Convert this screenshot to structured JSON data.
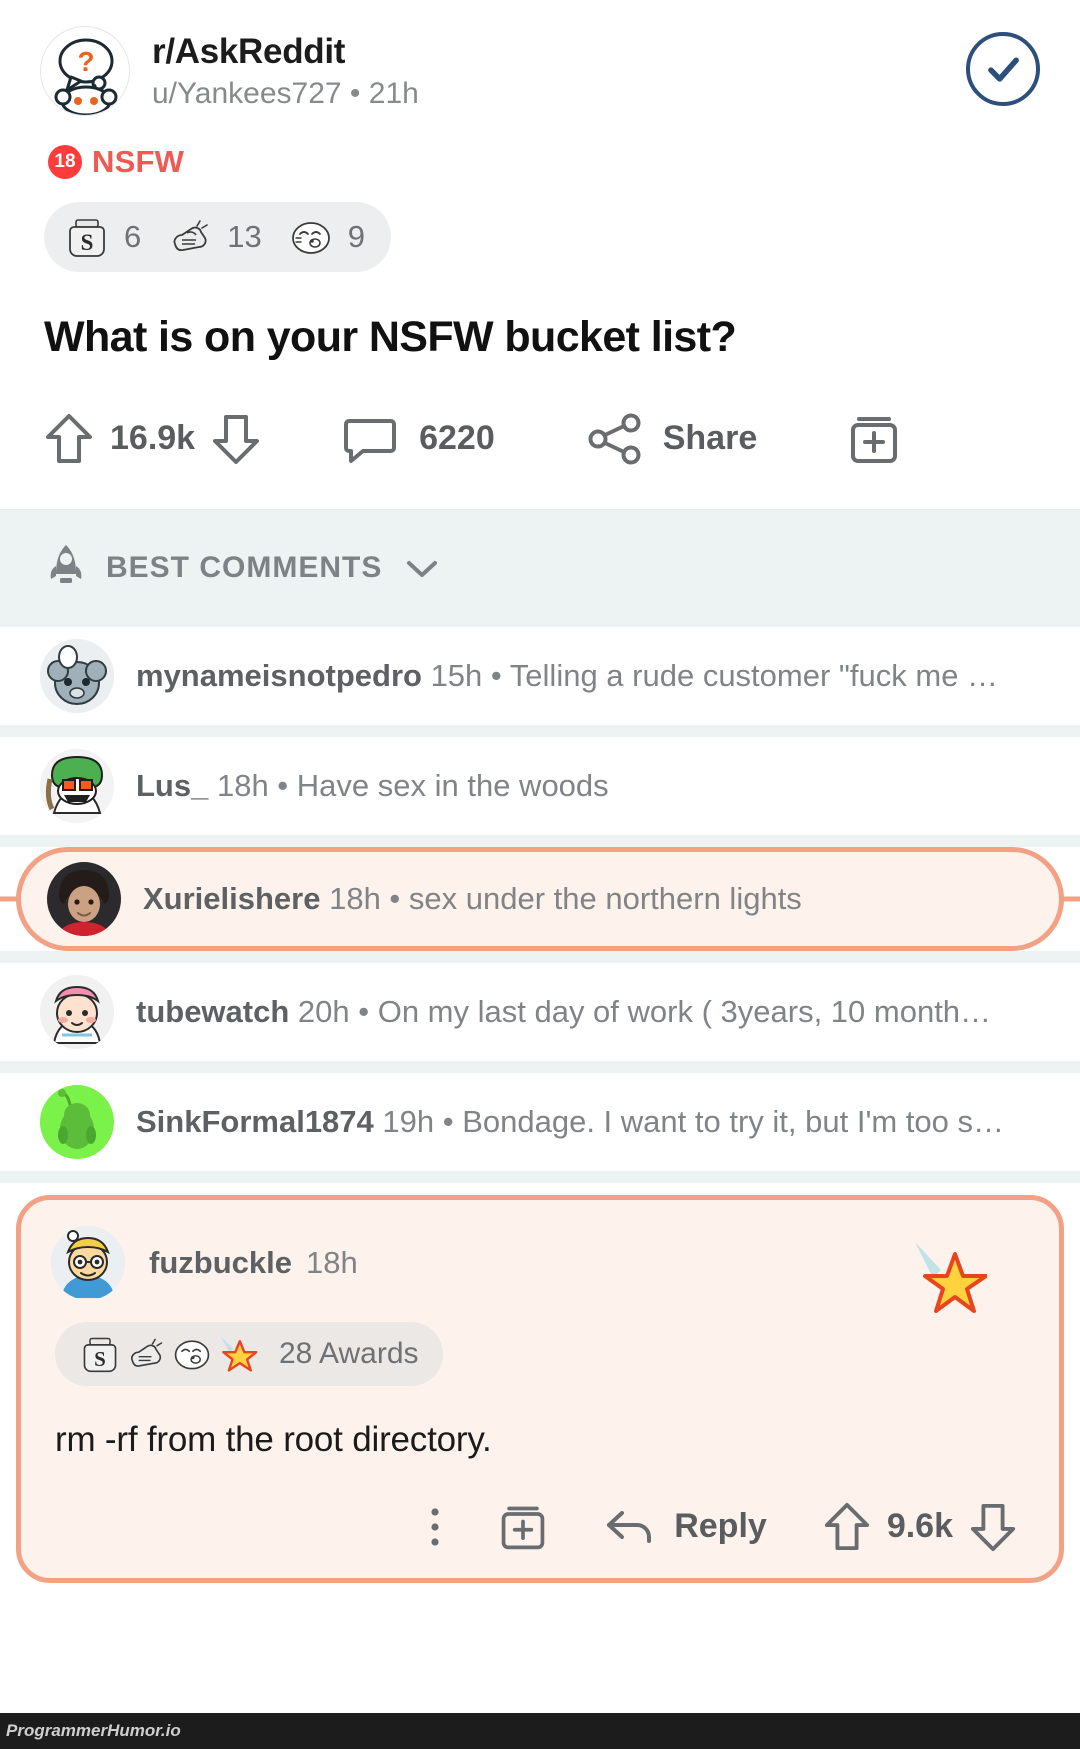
{
  "post": {
    "subreddit": "r/AskReddit",
    "author_line": "u/Yankees727 • 21h",
    "verified_icon": "check-circle-icon",
    "nsfw_badge_number": "18",
    "nsfw_label": "NSFW",
    "awards": [
      {
        "icon": "silver-award-icon",
        "count": "6"
      },
      {
        "icon": "bro-fist-award-icon",
        "count": "13"
      },
      {
        "icon": "wholesome-seal-award-icon",
        "count": "9"
      }
    ],
    "title": "What is on your NSFW bucket list?",
    "upvotes": "16.9k",
    "comments": "6220",
    "share_label": "Share",
    "award_button_icon": "gift-award-icon",
    "upvote_icon": "arrow-up-icon",
    "downvote_icon": "arrow-down-icon",
    "comment_icon": "speech-bubble-icon",
    "share_icon": "share-node-icon"
  },
  "sort": {
    "icon": "rocket-icon",
    "label": "BEST COMMENTS",
    "chevron": "chevron-down-icon"
  },
  "comments": [
    {
      "user": "mynameisnotpedro",
      "meta": " 15h • Telling a rude customer \"fuck me …",
      "highlighted": false
    },
    {
      "user": "Lus_",
      "meta": " 18h • Have sex in the woods",
      "highlighted": false
    },
    {
      "user": "Xurielishere",
      "meta": " 18h • sex under the northern lights",
      "highlighted": true
    },
    {
      "user": "tubewatch",
      "meta": " 20h • On my last day of work ( 3years, 10 month…",
      "highlighted": false
    },
    {
      "user": "SinkFormal1874",
      "meta": " 19h • Bondage. I want to try it, but I'm too s…",
      "highlighted": false
    }
  ],
  "featured_comment": {
    "user": "fuzbuckle",
    "time": "18h",
    "awards_label": "28 Awards",
    "award_icons": [
      "silver-award-icon",
      "bro-fist-award-icon",
      "wholesome-seal-award-icon",
      "starstruck-award-icon"
    ],
    "body": "rm -rf from the root directory.",
    "reply_label": "Reply",
    "votes": "9.6k",
    "overflow_icon": "kebab-menu-icon",
    "gift_icon": "gift-award-icon",
    "reply_icon": "reply-arrow-icon",
    "upvote_icon": "arrow-up-icon",
    "downvote_icon": "arrow-down-icon",
    "star_icon": "shooting-star-icon"
  },
  "watermark": "ProgrammerHumor.io",
  "colors": {
    "accent_orange": "#f2a184",
    "highlight_bg": "#fdf2ec",
    "nsfw_red": "#f05a52",
    "verified_blue": "#2d4f7c",
    "section_bg": "#edf2f2"
  }
}
